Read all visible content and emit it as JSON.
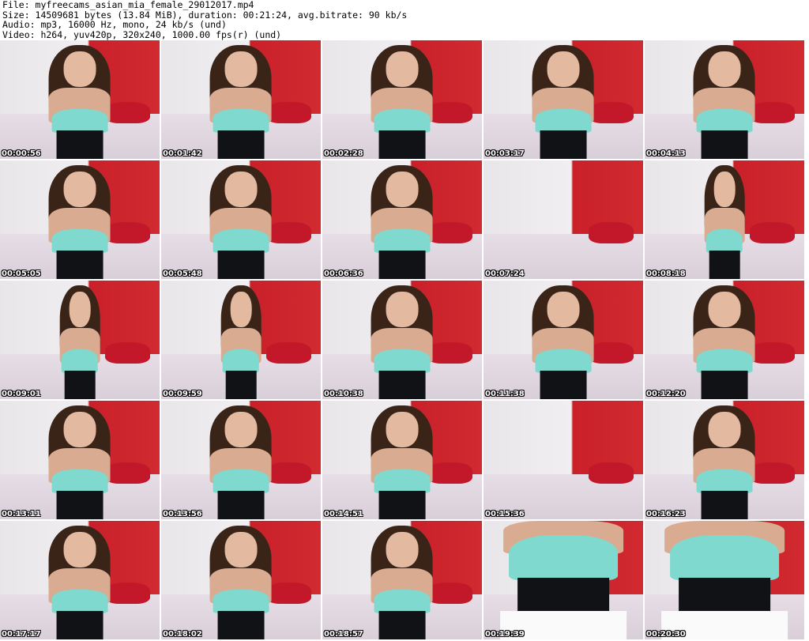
{
  "header": {
    "line1": "File: myfreecams_asian_mia_female_29012017.mp4",
    "line2": "Size: 14509681 bytes (13.84 MiB), duration: 00:21:24, avg.bitrate: 90 kb/s",
    "line3": "Audio: mp3, 16000 Hz, mono, 24 kb/s (und)",
    "line4": "Video: h264, yuv420p, 320x240, 1000.00 fps(r) (und)"
  },
  "thumbnails": [
    {
      "timestamp": "00:00:56"
    },
    {
      "timestamp": "00:01:42"
    },
    {
      "timestamp": "00:02:28"
    },
    {
      "timestamp": "00:03:17"
    },
    {
      "timestamp": "00:04:13"
    },
    {
      "timestamp": "00:05:05"
    },
    {
      "timestamp": "00:05:48"
    },
    {
      "timestamp": "00:06:36"
    },
    {
      "timestamp": "00:07:24"
    },
    {
      "timestamp": "00:08:18"
    },
    {
      "timestamp": "00:09:01"
    },
    {
      "timestamp": "00:09:59"
    },
    {
      "timestamp": "00:10:38"
    },
    {
      "timestamp": "00:11:38"
    },
    {
      "timestamp": "00:12:20"
    },
    {
      "timestamp": "00:13:11"
    },
    {
      "timestamp": "00:13:56"
    },
    {
      "timestamp": "00:14:51"
    },
    {
      "timestamp": "00:15:36"
    },
    {
      "timestamp": "00:16:23"
    },
    {
      "timestamp": "00:17:17"
    },
    {
      "timestamp": "00:18:02"
    },
    {
      "timestamp": "00:18:57"
    },
    {
      "timestamp": "00:19:39"
    },
    {
      "timestamp": "00:20:30"
    }
  ],
  "colors": {
    "background": "#ffffff",
    "wall_red": "#c9202a",
    "top_mint": "#7fd9cf",
    "corset": "#111216"
  }
}
